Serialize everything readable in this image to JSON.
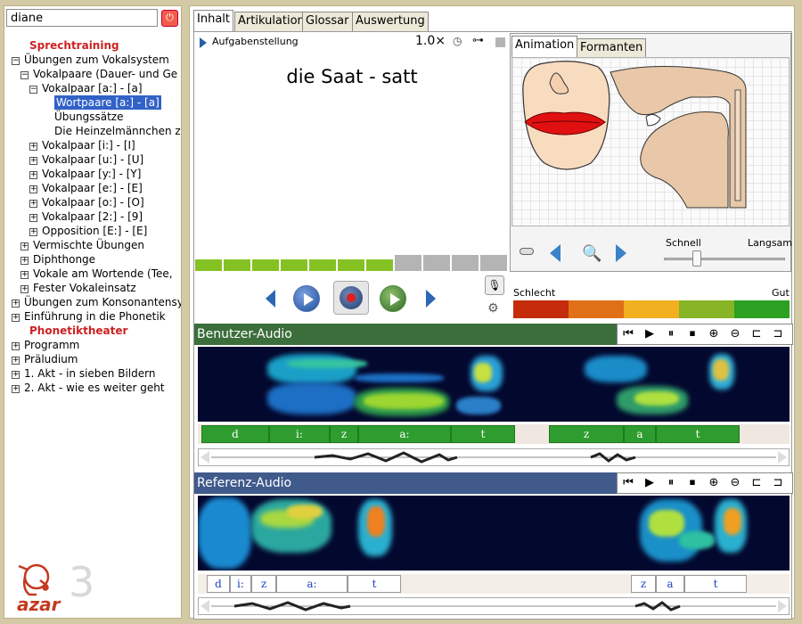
{
  "user": {
    "name": "diane"
  },
  "tree": [
    {
      "label": "Sprechtraining",
      "level": 0,
      "type": "section"
    },
    {
      "label": "Übungen zum Vokalsystem",
      "level": 0,
      "type": "open"
    },
    {
      "label": "Vokalpaare (Dauer- und Ge",
      "level": 1,
      "type": "open"
    },
    {
      "label": "Vokalpaar [a:] - [a]",
      "level": 2,
      "type": "open"
    },
    {
      "label": "Wortpaare [a:] - [a]",
      "level": 3,
      "type": "selected"
    },
    {
      "label": "Übungssätze",
      "level": 3,
      "type": "leaf"
    },
    {
      "label": "Die Heinzelmännchen zu",
      "level": 3,
      "type": "leaf"
    },
    {
      "label": "Vokalpaar [i:] - [I]",
      "level": 2,
      "type": "closed"
    },
    {
      "label": "Vokalpaar [u:] - [U]",
      "level": 2,
      "type": "closed"
    },
    {
      "label": "Vokalpaar [y:] - [Y]",
      "level": 2,
      "type": "closed"
    },
    {
      "label": "Vokalpaar [e:] - [E]",
      "level": 2,
      "type": "closed"
    },
    {
      "label": "Vokalpaar [o:] - [O]",
      "level": 2,
      "type": "closed"
    },
    {
      "label": "Vokalpaar [2:] - [9]",
      "level": 2,
      "type": "closed"
    },
    {
      "label": "Opposition [E:] - [E]",
      "level": 2,
      "type": "closed"
    },
    {
      "label": "Vermischte Übungen",
      "level": 1,
      "type": "closed"
    },
    {
      "label": "Diphthonge",
      "level": 1,
      "type": "closed"
    },
    {
      "label": "Vokale am Wortende (Tee,",
      "level": 1,
      "type": "closed"
    },
    {
      "label": "Fester Vokaleinsatz",
      "level": 1,
      "type": "closed"
    },
    {
      "label": "Übungen zum Konsonantensy",
      "level": 0,
      "type": "closed"
    },
    {
      "label": "Einführung in die Phonetik",
      "level": 0,
      "type": "closed"
    },
    {
      "label": "Phonetiktheater",
      "level": 0,
      "type": "section"
    },
    {
      "label": "Programm",
      "level": 0,
      "type": "closed"
    },
    {
      "label": "Präludium",
      "level": 0,
      "type": "closed"
    },
    {
      "label": "1. Akt - in sieben Bildern",
      "level": 0,
      "type": "closed"
    },
    {
      "label": "2. Akt - wie es weiter geht",
      "level": 0,
      "type": "closed"
    }
  ],
  "logo": {
    "text": "azar",
    "number": "3"
  },
  "tabs": {
    "main": [
      "Inhalt",
      "Artikulation",
      "Glossar",
      "Auswertung"
    ],
    "side": [
      "Animation",
      "Formanten"
    ]
  },
  "task": {
    "label": "Aufgabenstellung",
    "speed": "1.0×",
    "prompt": "die Saat - satt"
  },
  "progress": {
    "filled": [
      true,
      true,
      true,
      true,
      true,
      true,
      true,
      false,
      false,
      false,
      false
    ]
  },
  "animation": {
    "fast_label": "Schnell",
    "slow_label": "Langsam",
    "speed_value": 0.25
  },
  "rating": {
    "bad_label": "Schlecht",
    "good_label": "Gut",
    "colors": [
      "#c42c0c",
      "#e07018",
      "#f0b020",
      "#88b428",
      "#2ca020"
    ]
  },
  "user_audio": {
    "title": "Benutzer-Audio",
    "header_color": "#3c6e3c",
    "phonemes": [
      "d",
      "i:",
      "z",
      "a:",
      "t",
      "z",
      "a",
      "t"
    ]
  },
  "ref_audio": {
    "title": "Referenz-Audio",
    "header_color": "#405a8c",
    "phonemes": [
      "d",
      "i:",
      "z",
      "a:",
      "t",
      "z",
      "a",
      "t"
    ]
  },
  "colors": {
    "accent_red": "#cc2222",
    "selection": "#3262c8",
    "progress_green": "#84c224",
    "progress_grey": "#b4b4b4"
  }
}
